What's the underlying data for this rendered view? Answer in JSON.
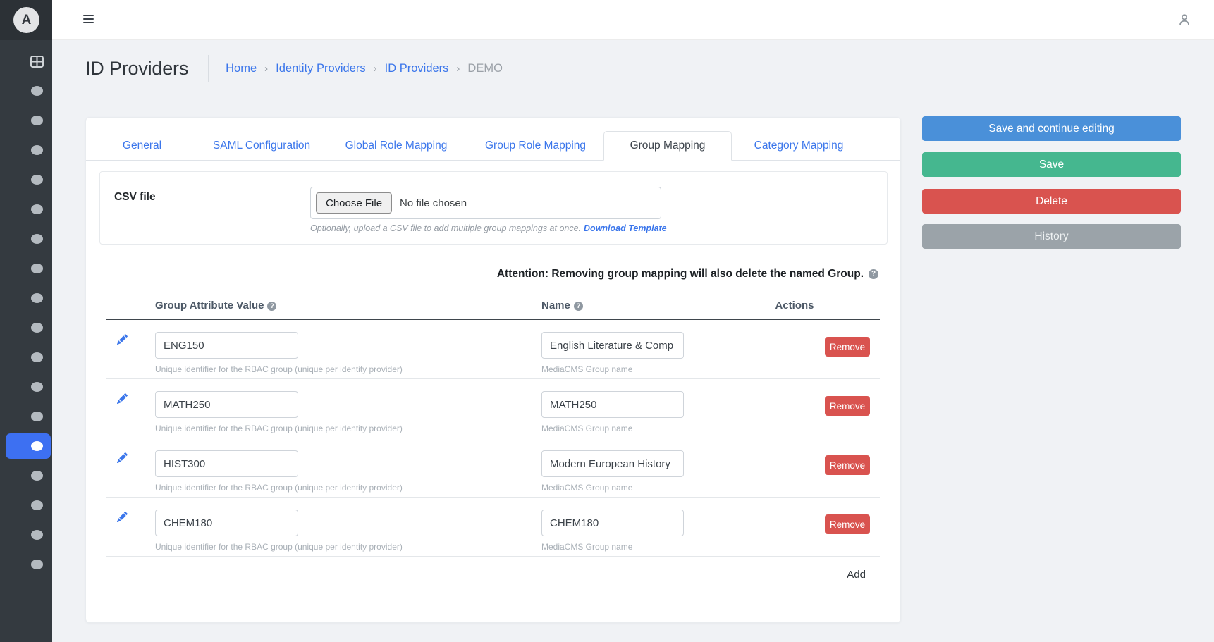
{
  "sidebar": {
    "logo_letter": "A",
    "menu_dot_count": 17,
    "active_dot_index": 12
  },
  "header": {
    "title": "ID Providers",
    "breadcrumb": [
      "Home",
      "Identity Providers",
      "ID Providers",
      "DEMO"
    ],
    "breadcrumb_separator": "›"
  },
  "tabs": [
    {
      "label": "General",
      "active": false
    },
    {
      "label": "SAML Configuration",
      "active": false
    },
    {
      "label": "Global Role Mapping",
      "active": false
    },
    {
      "label": "Group Role Mapping",
      "active": false
    },
    {
      "label": "Group Mapping",
      "active": true
    },
    {
      "label": "Category Mapping",
      "active": false
    }
  ],
  "csv_section": {
    "label": "CSV file",
    "choose_file_label": "Choose File",
    "no_file_text": "No file chosen",
    "helper_text": "Optionally, upload a CSV file to add multiple group mappings at once.",
    "download_link": "Download Template"
  },
  "attention": {
    "text": "Attention: Removing group mapping will also delete the named Group.",
    "help_glyph": "?"
  },
  "mapping_table": {
    "headers": {
      "attribute": "Group Attribute Value",
      "name": "Name",
      "actions": "Actions"
    },
    "help_glyph": "?",
    "attribute_helper": "Unique identifier for the RBAC group (unique per identity provider)",
    "name_helper": "MediaCMS Group name",
    "remove_label": "Remove",
    "add_label": "Add",
    "rows": [
      {
        "attribute_value": "ENG150",
        "name_value": "English Literature & Comp"
      },
      {
        "attribute_value": "MATH250",
        "name_value": "MATH250"
      },
      {
        "attribute_value": "HIST300",
        "name_value": "Modern European History"
      },
      {
        "attribute_value": "CHEM180",
        "name_value": "CHEM180"
      }
    ]
  },
  "actions_panel": {
    "buttons": [
      {
        "label": "Save and continue editing",
        "color": "#4a90d9"
      },
      {
        "label": "Save",
        "color": "#45b78f"
      },
      {
        "label": "Delete",
        "color": "#d9534f"
      },
      {
        "label": "History",
        "color": "#9ba3a9"
      }
    ]
  },
  "colors": {
    "sidebar_bg": "#343a40",
    "active_item_blue": "#3d70f2",
    "link_blue": "#3b76eb",
    "remove_red": "#d9534f",
    "content_bg": "#f0f2f5"
  }
}
